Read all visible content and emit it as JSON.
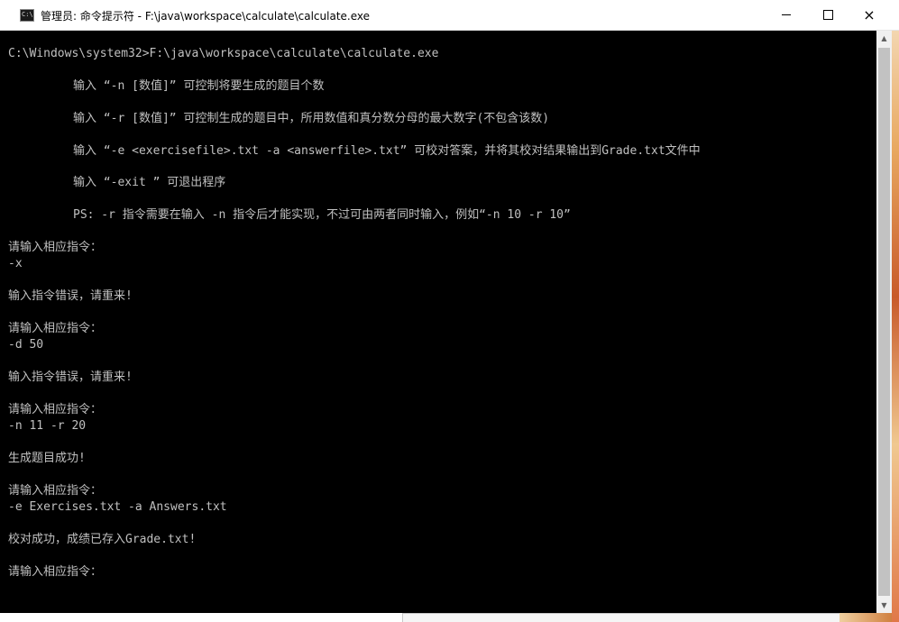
{
  "window": {
    "title": "管理员: 命令提示符 - F:\\java\\workspace\\calculate\\calculate.exe",
    "icon_label": "C:\\",
    "icon": "cmd-icon",
    "controls": {
      "minimize": "minimize-icon",
      "maximize": "maximize-icon",
      "close": "×"
    }
  },
  "console": {
    "text_color": "#c0c0c0",
    "background": "#000000",
    "lines": [
      "C:\\Windows\\system32>F:\\java\\workspace\\calculate\\calculate.exe",
      "输入 “-n [数值]” 可控制将要生成的题目个数",
      "输入 “-r [数值]” 可控制生成的题目中，所用数值和真分数分母的最大数字(不包含该数)",
      "输入 “-e <exercisefile>.txt -a <answerfile>.txt” 可校对答案，并将其校对结果输出到Grade.txt文件中",
      "输入 “-exit ” 可退出程序",
      "PS: -r 指令需要在输入 -n 指令后才能实现，不过可由两者同时输入，例如“-n 10 -r 10”",
      "请输入相应指令：",
      "-x",
      "输入指令错误，请重来!",
      "请输入相应指令：",
      "-d 50",
      "输入指令错误，请重来!",
      "请输入相应指令：",
      "-n 11 -r 20",
      "生成题目成功!",
      "请输入相应指令：",
      "-e Exercises.txt -a Answers.txt",
      "校对成功，成绩已存入Grade.txt!",
      "请输入相应指令："
    ]
  },
  "scrollbar": {
    "up_arrow": "▲",
    "down_arrow": "▼"
  }
}
